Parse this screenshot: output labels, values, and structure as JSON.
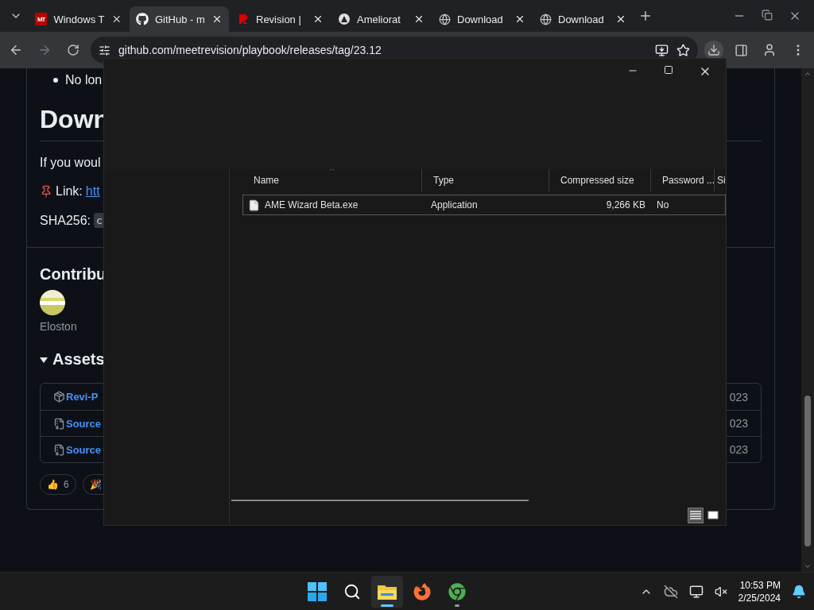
{
  "browser": {
    "tabs": [
      {
        "kind": "mt",
        "icon_text": "MT",
        "title": "Windows T",
        "selected": false
      },
      {
        "kind": "github",
        "title": "GitHub - m",
        "selected": true
      },
      {
        "kind": "revision",
        "title": "Revision |",
        "selected": false
      },
      {
        "kind": "ame",
        "title": "Ameliorat",
        "selected": false
      },
      {
        "kind": "globe",
        "title": "Download",
        "selected": false
      },
      {
        "kind": "globe",
        "title": "Download",
        "selected": false
      }
    ],
    "address": "github.com/meetrevision/playbook/releases/tag/23.12"
  },
  "page": {
    "bullet": "No lon",
    "heading": "Down",
    "intro": "If you woul",
    "link_label": "Link:",
    "link": "htt",
    "sha_label": "SHA256:",
    "sha": "c",
    "contributors_heading": "Contribu",
    "contributor": "Eloston",
    "assets_heading": "Assets",
    "assets": [
      {
        "kind": "package",
        "name": "Revi-P",
        "date": "023"
      },
      {
        "kind": "archive",
        "name": "Source",
        "date": "023"
      },
      {
        "kind": "archive",
        "name": "Source",
        "date": "023"
      }
    ],
    "reactions": [
      {
        "emoji": "👍",
        "count": "6"
      },
      {
        "emoji": "🎉"
      }
    ]
  },
  "explorer": {
    "columns": [
      {
        "label": "Name",
        "sorted": true
      },
      {
        "label": "Type",
        "sorted": false
      },
      {
        "label": "Compressed size",
        "sorted": false
      },
      {
        "label": "Password ...",
        "sorted": false
      },
      {
        "label": "Si",
        "sorted": false
      }
    ],
    "rows": [
      {
        "name": "AME Wizard Beta.exe",
        "type": "Application",
        "compressed_size": "9,266 KB",
        "password": "No"
      }
    ],
    "views": [
      {
        "kind": "details",
        "selected": true
      },
      {
        "kind": "preview",
        "selected": false
      }
    ]
  },
  "taskbar": {
    "apps": [
      {
        "kind": "start",
        "selected": false,
        "running": false
      },
      {
        "kind": "search",
        "selected": false,
        "running": false
      },
      {
        "kind": "explorer",
        "selected": true,
        "running": true
      },
      {
        "kind": "firefox",
        "selected": false,
        "running": false
      },
      {
        "kind": "chrome",
        "selected": false,
        "running": true
      }
    ],
    "time": "10:53 PM",
    "date": "2/25/2024"
  }
}
